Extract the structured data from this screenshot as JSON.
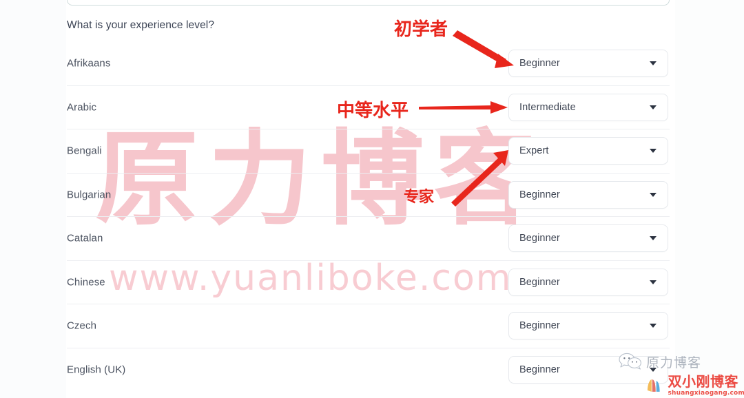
{
  "form": {
    "question": "What is your experience level?",
    "rows": [
      {
        "language": "Afrikaans",
        "level": "Beginner"
      },
      {
        "language": "Arabic",
        "level": "Intermediate"
      },
      {
        "language": "Bengali",
        "level": "Expert"
      },
      {
        "language": "Bulgarian",
        "level": "Beginner"
      },
      {
        "language": "Catalan",
        "level": "Beginner"
      },
      {
        "language": "Chinese",
        "level": "Beginner"
      },
      {
        "language": "Czech",
        "level": "Beginner"
      },
      {
        "language": "English (UK)",
        "level": "Beginner"
      }
    ]
  },
  "annotations": {
    "color": "#e8261c",
    "beginner": "初学者",
    "intermediate": "中等水平",
    "expert": "专家"
  },
  "watermarks": {
    "big": "原力博客",
    "url": "www.yuanliboke.com",
    "color": "#f6c6cc"
  },
  "badges": {
    "wechat_icon": "wechat-icon",
    "wechat_label": "原力博客",
    "sxg_title": "双小刚博客",
    "sxg_url": "shuangxiaogang.com"
  },
  "icons": {
    "caret": "chevron-down-icon"
  }
}
